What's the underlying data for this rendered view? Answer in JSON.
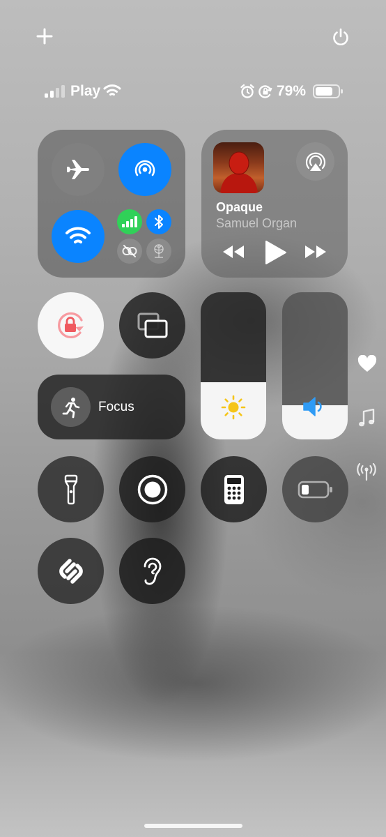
{
  "status": {
    "carrier": "Play",
    "battery_percent": "79%",
    "signal_bars_filled": 2,
    "battery_level": 0.79
  },
  "top": {
    "add_icon": "plus-icon",
    "power_icon": "power-icon"
  },
  "connectivity": {
    "airplane_icon": "airplane-icon",
    "airdrop_icon": "airdrop-icon",
    "wifi_icon": "wifi-icon",
    "cellular_icon": "cellular-icon",
    "bluetooth_icon": "bluetooth-icon",
    "link_icon": "link-icon",
    "personal_hotspot_icon": "hotspot-icon"
  },
  "now_playing": {
    "title": "Opaque",
    "artist": "Samuel Organ",
    "airplay_icon": "airplay-icon"
  },
  "controls": {
    "focus_label": "Focus",
    "brightness_level": 0.39,
    "volume_level": 0.23
  },
  "side_icons": [
    "heart-icon",
    "music-note-icon",
    "broadcast-icon"
  ],
  "colors": {
    "accent_blue": "#0a84ff",
    "green": "#30d158",
    "orientation_lock_red": "#ff3b30",
    "brightness_sun": "#f5c518",
    "volume_speaker": "#2f9bf5"
  }
}
